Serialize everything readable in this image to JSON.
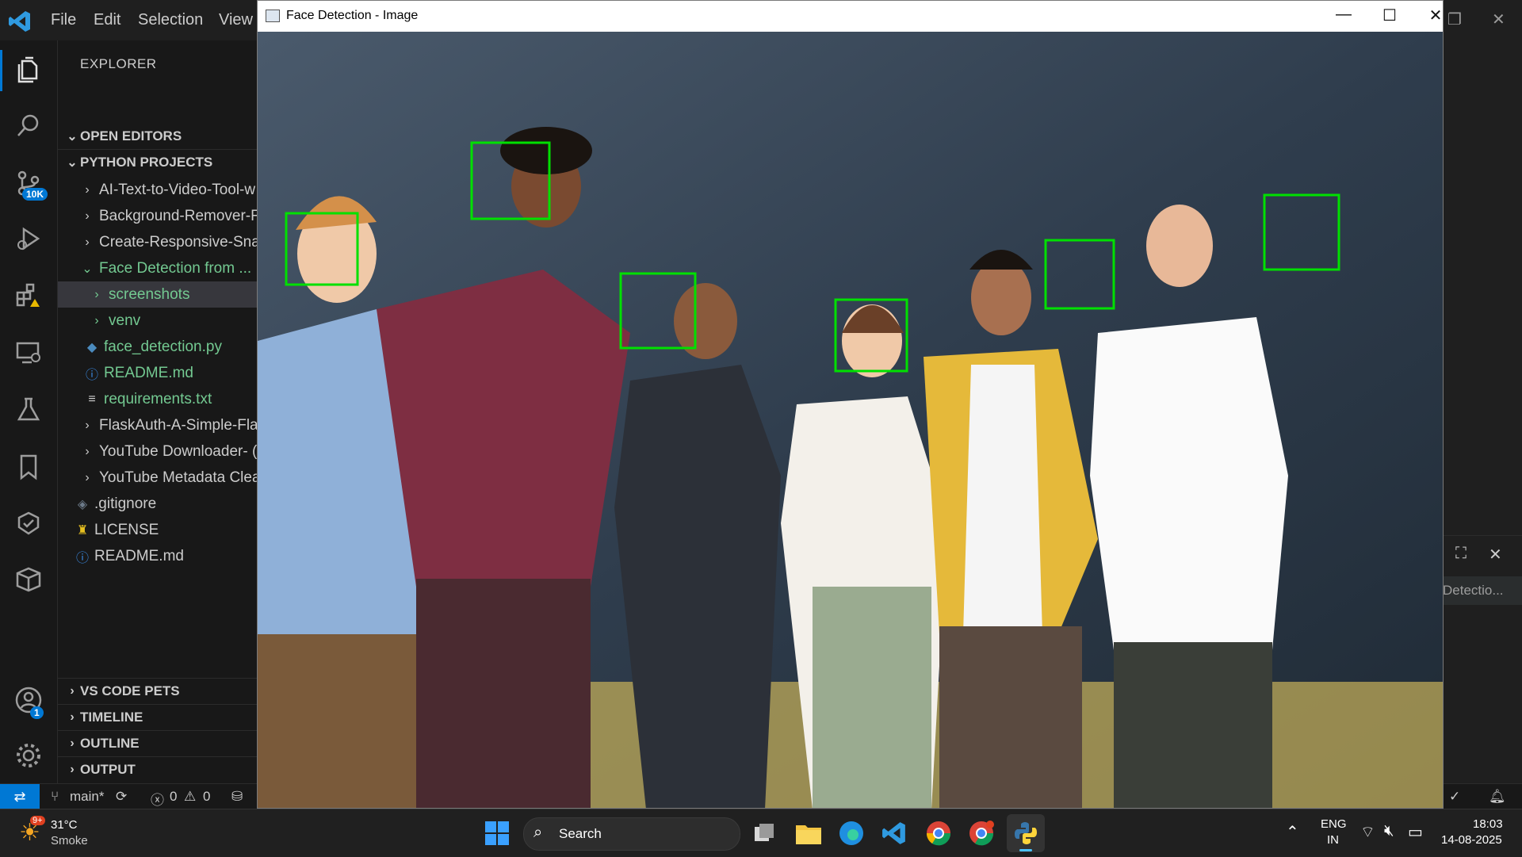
{
  "vscode": {
    "menu": [
      "File",
      "Edit",
      "Selection",
      "View"
    ]
  },
  "activity_badges": {
    "source_control": "10K",
    "accounts": "1"
  },
  "sidebar": {
    "title": "EXPLORER",
    "open_editors": "OPEN EDITORS",
    "project": "PYTHON PROJECTS",
    "items": [
      {
        "label": "AI-Text-to-Video-Tool-w",
        "chev": "›"
      },
      {
        "label": "Background-Remover-F",
        "chev": "›"
      },
      {
        "label": "Create-Responsive-Snal",
        "chev": "›"
      },
      {
        "label": "Face Detection from ...",
        "chev": "⌄"
      },
      {
        "label": "screenshots",
        "chev": "›"
      },
      {
        "label": "venv",
        "chev": "›"
      },
      {
        "label": "face_detection.py",
        "chev": ""
      },
      {
        "label": "README.md",
        "chev": ""
      },
      {
        "label": "requirements.txt",
        "chev": ""
      },
      {
        "label": "FlaskAuth-A-Simple-Fla",
        "chev": "›"
      },
      {
        "label": "YouTube Downloader- (",
        "chev": "›"
      },
      {
        "label": "YouTube Metadata Clea",
        "chev": "›"
      },
      {
        "label": ".gitignore",
        "chev": ""
      },
      {
        "label": "LICENSE",
        "chev": ""
      },
      {
        "label": "README.md",
        "chev": ""
      }
    ],
    "bottom_sections": [
      "VS CODE PETS",
      "TIMELINE",
      "OUTLINE",
      "OUTPUT"
    ]
  },
  "statusbar": {
    "branch": "main*",
    "errors": "0",
    "warnings": "0"
  },
  "right_panel": {
    "tab_label": "Detectio..."
  },
  "image_window": {
    "title": "Face Detection - Image",
    "min": "—",
    "max": "☐",
    "close": "✕"
  },
  "taskbar": {
    "weather_temp": "31°C",
    "weather_desc": "Smoke",
    "weather_badge": "9+",
    "search_label": "Search",
    "lang_top": "ENG",
    "lang_bottom": "IN",
    "time": "18:03",
    "date": "14-08-2025"
  },
  "colors": {
    "accent": "#0078d4",
    "box": "#00e000",
    "green_text": "#73c991"
  }
}
